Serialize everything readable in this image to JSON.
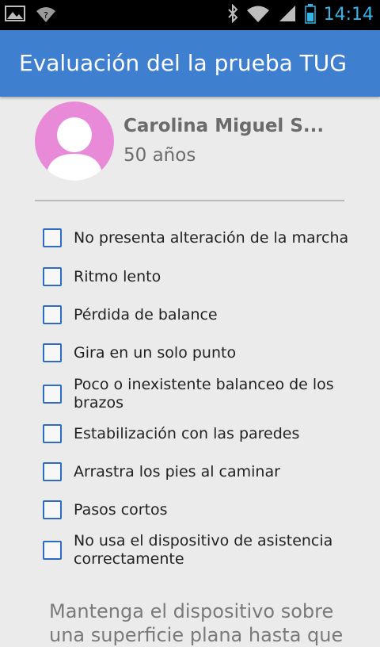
{
  "status_bar": {
    "time": "14:14",
    "icons": [
      "image-icon",
      "wifi-question-icon",
      "bluetooth-icon",
      "wifi-icon",
      "signal-icon",
      "battery-icon"
    ]
  },
  "app_bar": {
    "title": "Evaluación del la prueba TUG",
    "color": "#3f7fcf"
  },
  "patient": {
    "name": "Carolina Miguel S...",
    "age": "50 años",
    "avatar_color": "#e88ad8"
  },
  "checklist": [
    {
      "label": "No presenta alteración de la marcha",
      "checked": false
    },
    {
      "label": "Ritmo lento",
      "checked": false
    },
    {
      "label": "Pérdida de balance",
      "checked": false
    },
    {
      "label": "Gira en un solo punto",
      "checked": false
    },
    {
      "label": "Poco o inexistente balanceo de los brazos",
      "checked": false
    },
    {
      "label": "Estabilización con las paredes",
      "checked": false
    },
    {
      "label": "Arrastra los pies al caminar",
      "checked": false
    },
    {
      "label": "Pasos cortos",
      "checked": false
    },
    {
      "label": "No usa el dispositivo de asistencia correctamente",
      "checked": false
    }
  ],
  "instructions": "Mantenga el dispositivo sobre una superficie plana hasta que"
}
